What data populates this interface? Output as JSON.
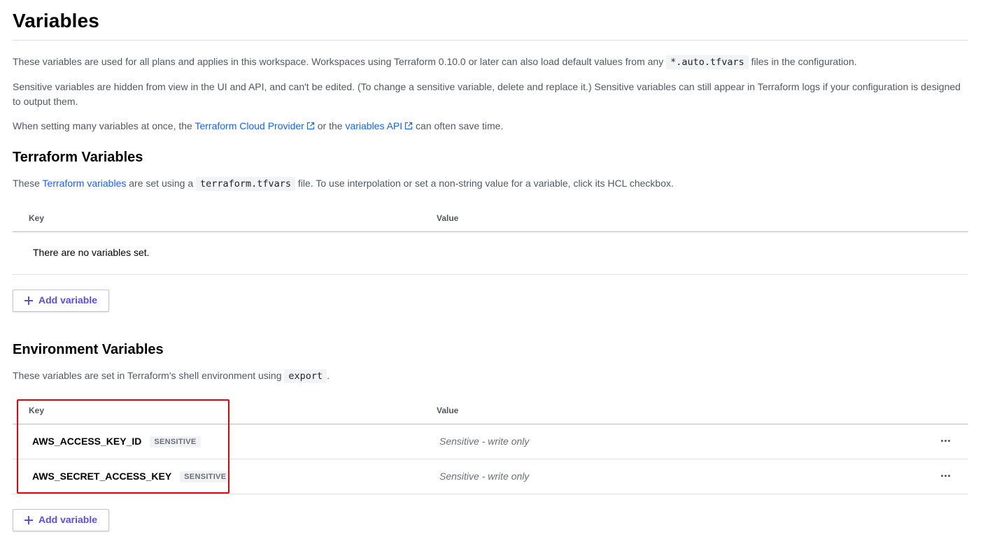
{
  "page": {
    "title": "Variables",
    "intro_1_before": "These variables are used for all plans and applies in this workspace. Workspaces using Terraform 0.10.0 or later can also load default values from any ",
    "intro_1_code": "*.auto.tfvars",
    "intro_1_after": " files in the configuration.",
    "intro_2": "Sensitive variables are hidden from view in the UI and API, and can't be edited. (To change a sensitive variable, delete and replace it.) Sensitive variables can still appear in Terraform logs if your configuration is designed to output them.",
    "intro_3_before": "When setting many variables at once, the ",
    "intro_3_link1": "Terraform Cloud Provider",
    "intro_3_middle": " or the ",
    "intro_3_link2": "variables API",
    "intro_3_after": " can often save time."
  },
  "terraform_vars": {
    "heading": "Terraform Variables",
    "desc_before": "These ",
    "desc_link": "Terraform variables",
    "desc_middle": " are set using a ",
    "desc_code": "terraform.tfvars",
    "desc_after": " file. To use interpolation or set a non-string value for a variable, click its HCL checkbox.",
    "col_key": "Key",
    "col_value": "Value",
    "empty_text": "There are no variables set.",
    "add_button": "Add variable"
  },
  "env_vars": {
    "heading": "Environment Variables",
    "desc_before": "These variables are set in Terraform's shell environment using ",
    "desc_code": "export",
    "desc_after": ".",
    "col_key": "Key",
    "col_value": "Value",
    "rows": [
      {
        "key": "AWS_ACCESS_KEY_ID",
        "badge": "SENSITIVE",
        "value": "Sensitive - write only"
      },
      {
        "key": "AWS_SECRET_ACCESS_KEY",
        "badge": "SENSITIVE",
        "value": "Sensitive - write only"
      }
    ],
    "add_button": "Add variable"
  },
  "colors": {
    "link": "#1563ff",
    "button_text": "#5c4ee5",
    "highlight": "#e8000b"
  }
}
